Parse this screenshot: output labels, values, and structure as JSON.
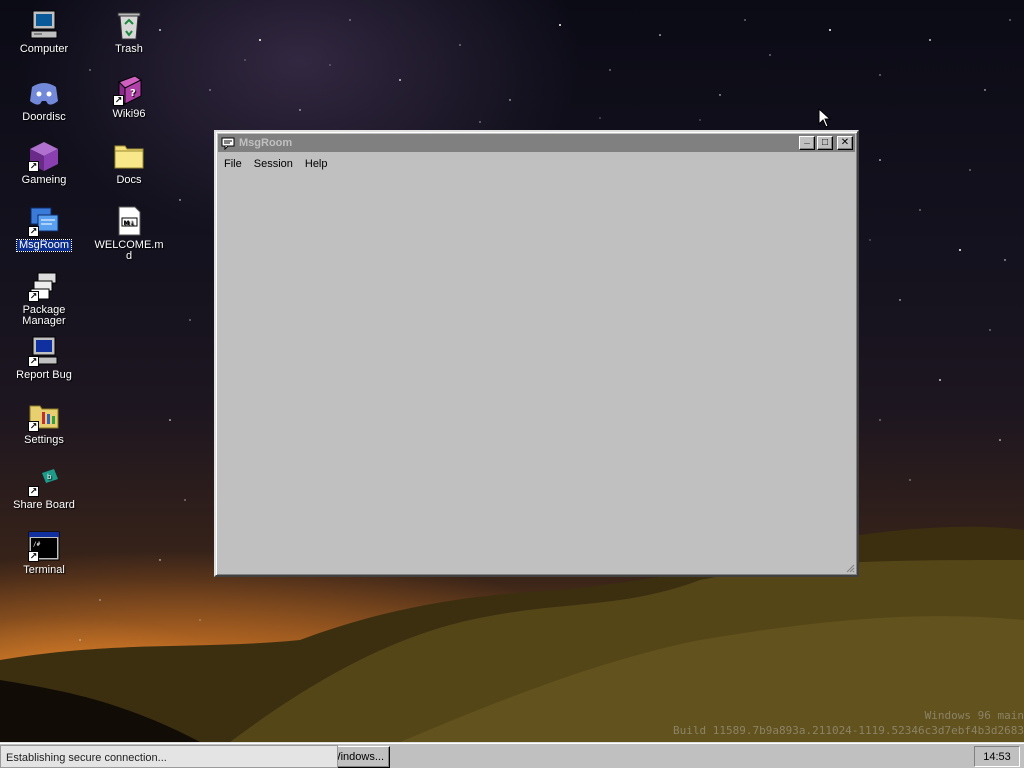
{
  "desktop": {
    "icons": [
      {
        "label": "Computer"
      },
      {
        "label": "Trash"
      },
      {
        "label": "Doordisc"
      },
      {
        "label": "Wiki96"
      },
      {
        "label": "Gameing"
      },
      {
        "label": "Docs"
      },
      {
        "label": "MsgRoom"
      },
      {
        "label": "WELCOME.m d"
      },
      {
        "label": "Package Manager"
      },
      {
        "label": "Report Bug"
      },
      {
        "label": "Settings"
      },
      {
        "label": "Share Board"
      },
      {
        "label": "Terminal"
      }
    ]
  },
  "window": {
    "title": "MsgRoom",
    "menu": [
      "File",
      "Session",
      "Help"
    ],
    "buttons": {
      "minimize": "_",
      "maximize": "□",
      "close": "✕"
    }
  },
  "watermark": {
    "line1": "Windows 96 main",
    "line2": "Build 11589.7b9a893a.211024-1119.52346c3d7ebf4b3d2683"
  },
  "taskbar": {
    "button_label": "Windows...",
    "clock": "14:53",
    "toast": "Establishing secure connection..."
  },
  "colors": {
    "title_inactive": "#808080",
    "window_face": "#c0c0c0",
    "selection": "#0a2c8c"
  }
}
